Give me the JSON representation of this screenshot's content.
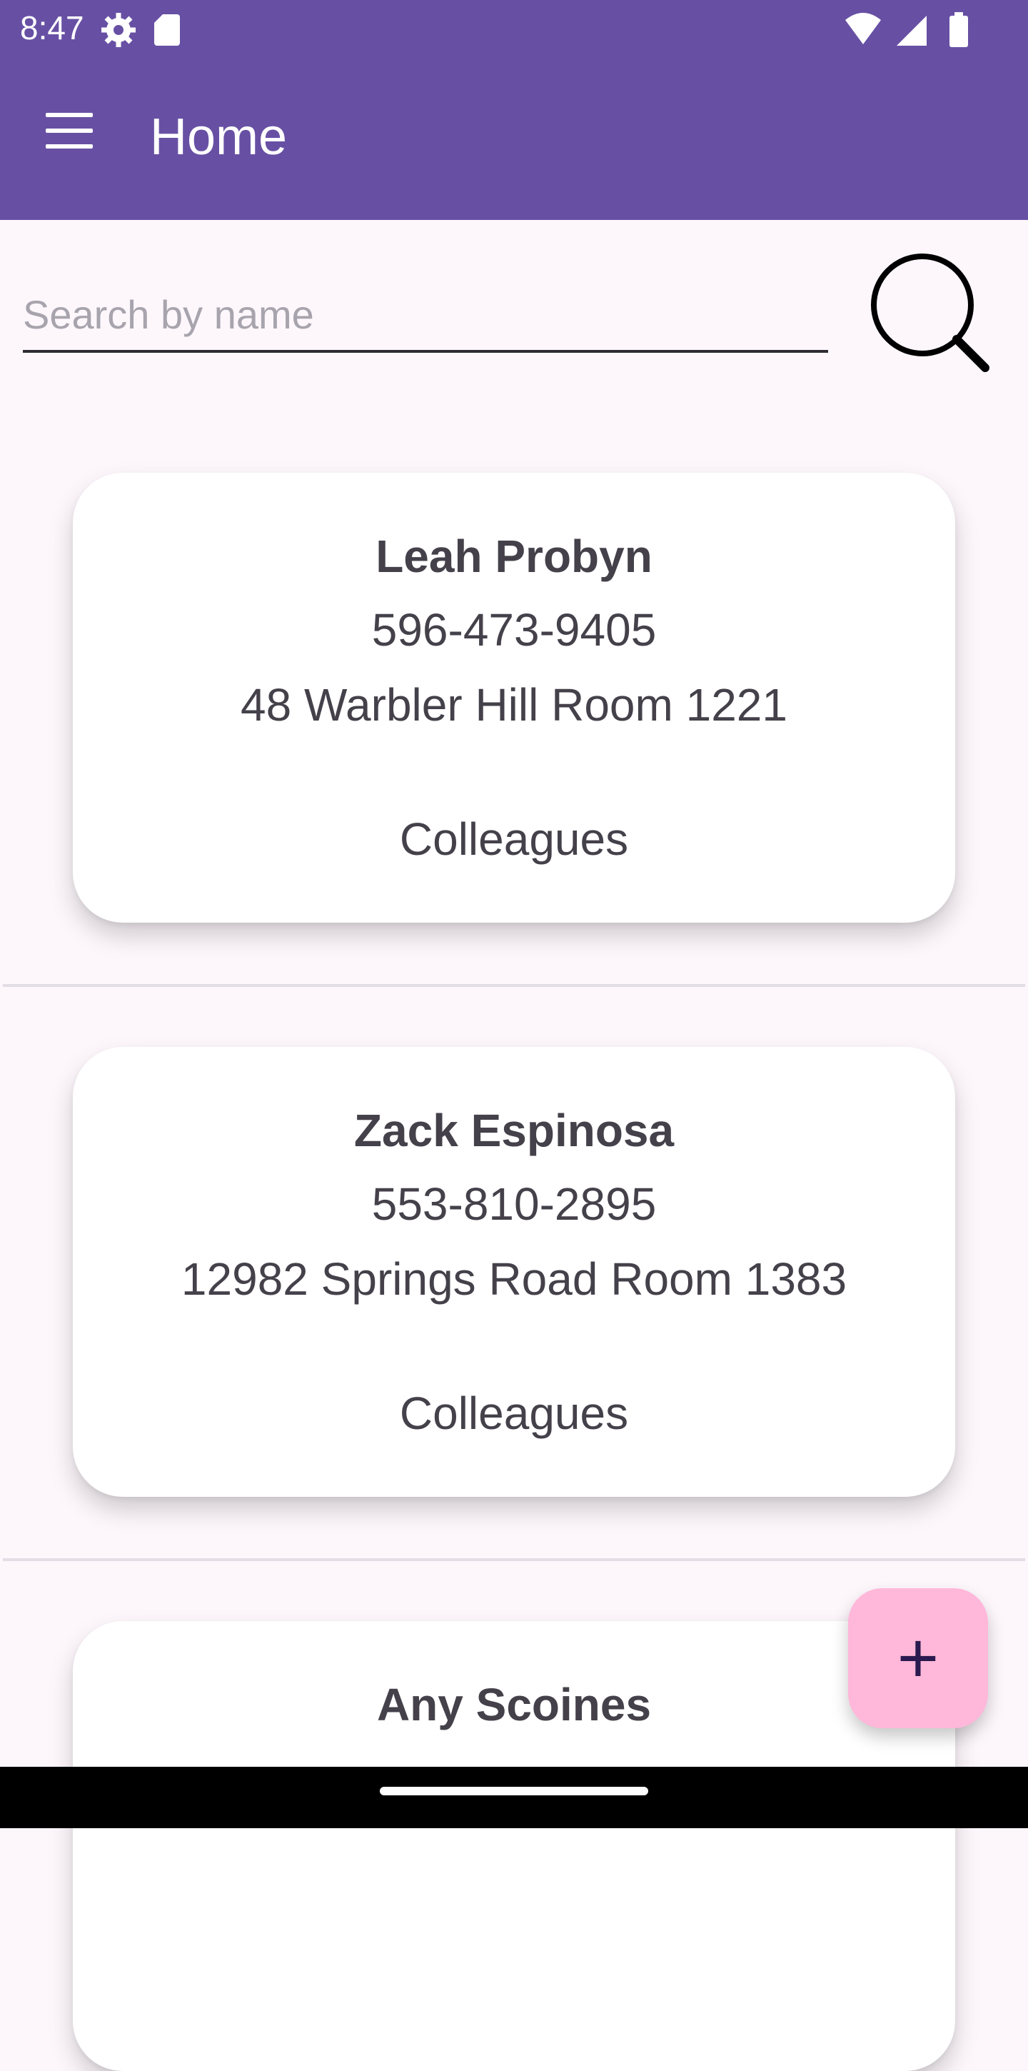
{
  "status_bar": {
    "time": "8:47",
    "left_icons": [
      "settings-gear-icon",
      "sd-card-icon"
    ],
    "right_icons": [
      "wifi-icon",
      "signal-icon",
      "battery-icon"
    ]
  },
  "app_bar": {
    "title": "Home",
    "menu_icon": "hamburger-menu-icon",
    "background_color": "#6750a4"
  },
  "search": {
    "placeholder": "Search by name",
    "value": "",
    "icon": "search-icon"
  },
  "contacts": [
    {
      "name": "Leah Probyn",
      "phone": "596-473-9405",
      "address": "48 Warbler Hill Room 1221",
      "group": "Colleagues"
    },
    {
      "name": "Zack Espinosa",
      "phone": "553-810-2895",
      "address": "12982 Springs Road Room 1383",
      "group": "Colleagues"
    },
    {
      "name": "Any Scoines",
      "phone": "",
      "address": "",
      "group": ""
    }
  ],
  "fab": {
    "label": "+",
    "icon": "add-icon",
    "color": "#ffb8d9"
  }
}
